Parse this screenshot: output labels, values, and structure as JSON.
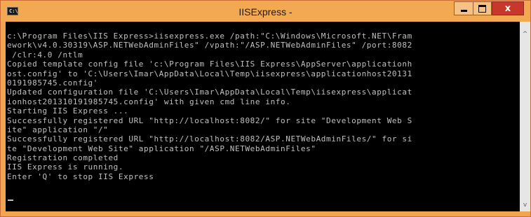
{
  "window": {
    "title": "IISExpress -",
    "icon": "console-icon",
    "icon_glyph": "C:\\",
    "controls": {
      "minimize": "minimize-icon",
      "maximize": "maximize-icon",
      "close": "close-icon",
      "close_glyph": "x"
    }
  },
  "console": {
    "lines": [
      "c:\\Program Files\\IIS Express>iisexpress.exe /path:\"C:\\Windows\\Microsoft.NET\\Fram",
      "ework\\v4.0.30319\\ASP.NETWebAdminFiles\" /vpath:\"/ASP.NETWebAdminFiles\" /port:8082",
      " /clr:4.0 /ntlm",
      "Copied template config file 'c:\\Program Files\\IIS Express\\AppServer\\applicationh",
      "ost.config' to 'C:\\Users\\Imar\\AppData\\Local\\Temp\\iisexpress\\applicationhost20131",
      "0191985745.config'",
      "Updated configuration file 'C:\\Users\\Imar\\AppData\\Local\\Temp\\iisexpress\\applicat",
      "ionhost201310191985745.config' with given cmd line info.",
      "Starting IIS Express ...",
      "Successfully registered URL \"http://localhost:8082/\" for site \"Development Web S",
      "ite\" application \"/\"",
      "Successfully registered URL \"http://localhost:8082/ASP.NETWebAdminFiles/\" for si",
      "te \"Development Web Site\" application \"/ASP.NETWebAdminFiles\"",
      "Registration completed",
      "IIS Express is running.",
      "Enter 'Q' to stop IIS Express"
    ]
  },
  "scrollbar": {
    "up_arrow": "^",
    "down_arrow": "v"
  },
  "colors": {
    "titlebar": "#f3a852",
    "console_bg": "#000000",
    "console_text": "#c0c0c0",
    "close_button": "#c7372c"
  }
}
